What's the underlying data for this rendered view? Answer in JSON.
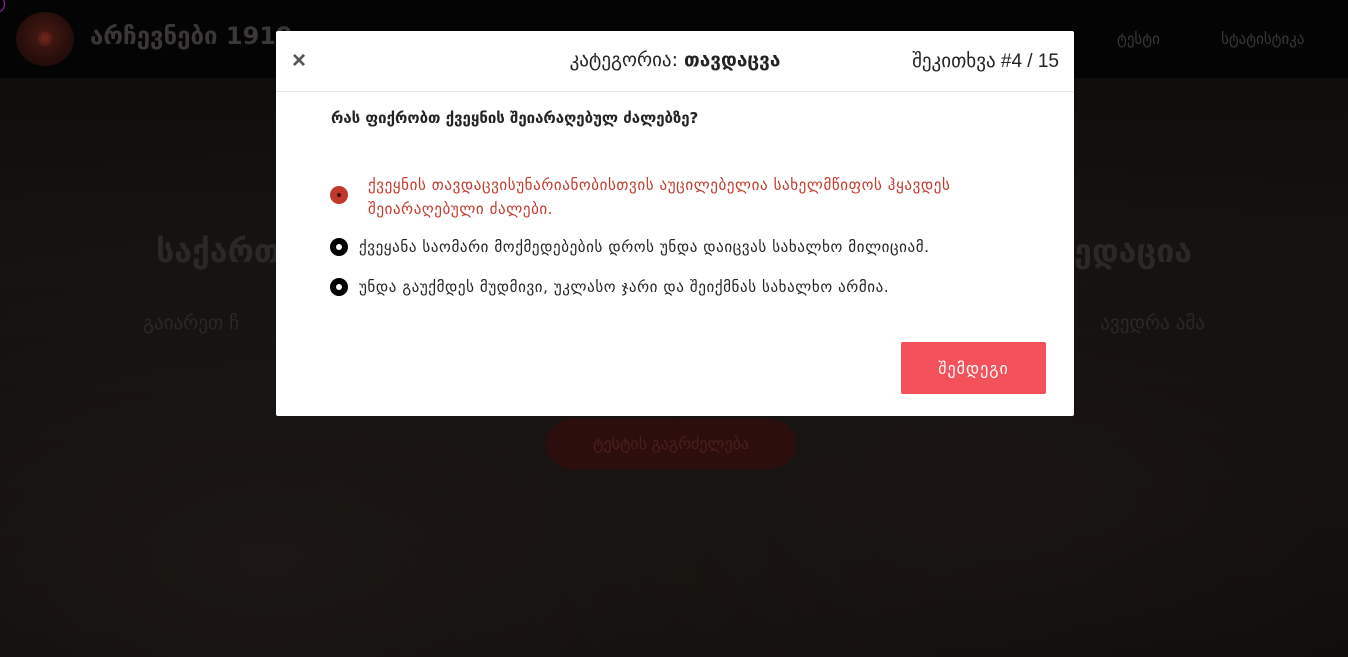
{
  "colors": {
    "accent": "#f4515a",
    "selected_answer": "#c0392b",
    "background_dim": "#0b0908"
  },
  "background_page": {
    "site_title": "არჩევნები 1919",
    "nav": [
      "ტესტი",
      "სტატისტიკა"
    ],
    "hero_title_left": "საქართ",
    "hero_title_right": "ედაცია",
    "hero_sub_left": "გაიარეთ ჩ",
    "hero_sub_right": "ავედრა ამა",
    "hero_button": "ტესტის გაგრძელება"
  },
  "modal": {
    "close_symbol": "×",
    "category_label": "კატეგორია:",
    "category_value": "თავდაცვა",
    "question_word": "შეკითხვა",
    "counter": "#4 / 15",
    "question": "რას ფიქრობთ ქვეყნის შეიარაღებულ ძალებზე?",
    "answers": [
      {
        "line1": "ქვეყნის თავდაცვისუნარიანობისთვის აუცილებელია სახელმწიფოს ჰყავდეს",
        "line2": "შეიარაღებული ძალები.",
        "selected": true
      },
      {
        "line1": "ქვეყანა საომარი მოქმედებების დროს უნდა დაიცვას სახალხო მილიციამ.",
        "selected": false
      },
      {
        "line1": "უნდა გაუქმდეს მუდმივი, უკლასო ჯარი და შეიქმნას სახალხო არმია.",
        "selected": false
      }
    ],
    "next_button": "შემდეგი"
  }
}
